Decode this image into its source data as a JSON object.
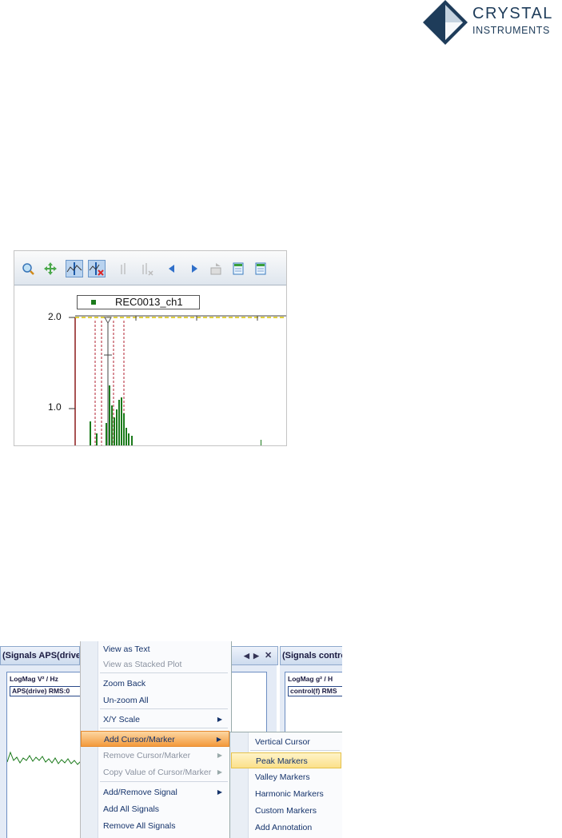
{
  "logo": {
    "line1": "CRYSTAL",
    "line2": "INSTRUMENTS",
    "diamond_color": "#1e3c5a"
  },
  "chart_window": {
    "toolbar_icons": [
      "zoom-icon",
      "pan-icon",
      "cursor-icon",
      "remove-cursor-icon",
      "peak-icon",
      "peak-remove-icon",
      "arrow-left-icon",
      "arrow-right-icon",
      "export-icon",
      "copy-icon",
      "save-icon"
    ],
    "legend": "REC0013_ch1",
    "y_ticks": [
      "2.0",
      "1.0"
    ],
    "series_color": "#1b7a1b"
  },
  "context_menu": {
    "left_panel": {
      "header": "(Signals APS(drive",
      "y_label": "LogMag V² / Hz",
      "trace_label": "APS(drive) RMS:0"
    },
    "right_panel": {
      "header": "(Signals control",
      "y_label": "LogMag g² / H",
      "trace_label": "control(f) RMS"
    },
    "menu_items": [
      {
        "label": "View as Text",
        "disabled": false,
        "submenu": false,
        "highlight": false
      },
      {
        "label": "View as Stacked Plot",
        "disabled": true,
        "submenu": false,
        "highlight": false
      },
      {
        "label": "Zoom Back",
        "disabled": false,
        "submenu": false,
        "highlight": false
      },
      {
        "label": "Un-zoom All",
        "disabled": false,
        "submenu": false,
        "highlight": false
      },
      {
        "label": "X/Y Scale",
        "disabled": false,
        "submenu": true,
        "highlight": false
      },
      {
        "label": "Add Cursor/Marker",
        "disabled": false,
        "submenu": true,
        "highlight": true
      },
      {
        "label": "Remove Cursor/Marker",
        "disabled": true,
        "submenu": true,
        "highlight": false
      },
      {
        "label": "Copy Value of Cursor/Marker",
        "disabled": true,
        "submenu": true,
        "highlight": false
      },
      {
        "label": "Add/Remove Signal",
        "disabled": false,
        "submenu": true,
        "highlight": false
      },
      {
        "label": "Add All Signals",
        "disabled": false,
        "submenu": false,
        "highlight": false
      },
      {
        "label": "Remove All Signals",
        "disabled": false,
        "submenu": false,
        "highlight": false
      }
    ],
    "submenu_items": [
      {
        "label": "Vertical Cursor",
        "highlight": false
      },
      {
        "label": "Peak Markers",
        "highlight": true
      },
      {
        "label": "Valley Markers",
        "highlight": false
      },
      {
        "label": "Harmonic Markers",
        "highlight": false
      },
      {
        "label": "Custom Markers",
        "highlight": false
      },
      {
        "label": "Add Annotation",
        "highlight": false
      }
    ]
  }
}
